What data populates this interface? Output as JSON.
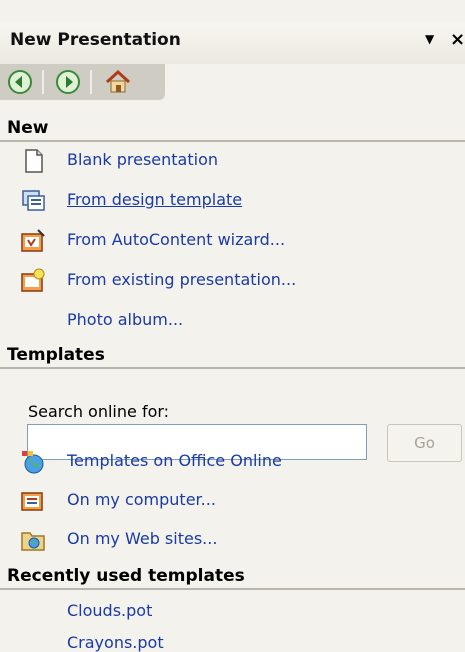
{
  "panel": {
    "title": "New Presentation",
    "dropdown_glyph": "▼",
    "close_glyph": "×"
  },
  "nav": {
    "back_icon": "back-arrow-icon",
    "forward_icon": "forward-arrow-icon",
    "home_icon": "home-icon"
  },
  "new_section": {
    "header": "New",
    "items": [
      {
        "label": "Blank presentation",
        "icon": "blank-page-icon"
      },
      {
        "label": "From design template",
        "icon": "design-template-icon"
      },
      {
        "label": "From AutoContent wizard...",
        "icon": "autocontent-wizard-icon"
      },
      {
        "label": "From existing presentation...",
        "icon": "existing-presentation-icon"
      },
      {
        "label": "Photo album...",
        "icon": ""
      }
    ]
  },
  "templates_section": {
    "header": "Templates",
    "search_label": "Search online for:",
    "search_value": "",
    "go_label": "Go",
    "items": [
      {
        "label": "Templates on Office Online",
        "icon": "office-online-icon"
      },
      {
        "label": "On my computer...",
        "icon": "my-computer-icon"
      },
      {
        "label": "On my Web sites...",
        "icon": "web-folder-icon"
      }
    ]
  },
  "recent_section": {
    "header": "Recently used templates",
    "items": [
      {
        "label": "Clouds.pot"
      },
      {
        "label": "Crayons.pot"
      }
    ]
  },
  "colors": {
    "link": "#1a3aa6",
    "panel_bg": "#f3f2ec",
    "nav_bg": "#cfcdc3"
  }
}
